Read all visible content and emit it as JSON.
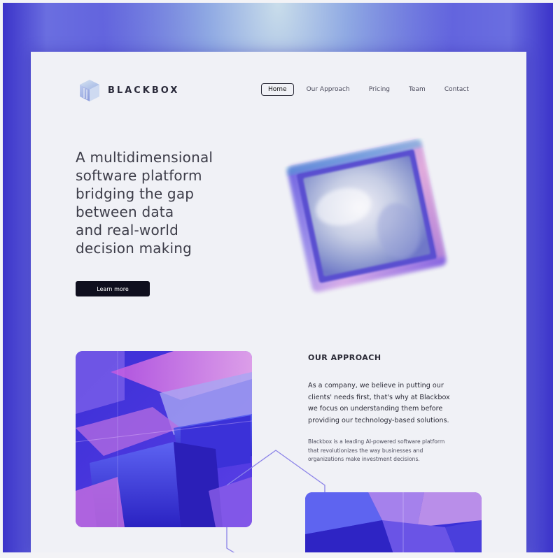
{
  "brand": {
    "name": "BLACKBOX",
    "logo_icon": "cube-logo-icon"
  },
  "nav": {
    "items": [
      {
        "label": "Home",
        "active": true
      },
      {
        "label": "Our Approach",
        "active": false
      },
      {
        "label": "Pricing",
        "active": false
      },
      {
        "label": "Team",
        "active": false
      },
      {
        "label": "Contact",
        "active": false
      }
    ]
  },
  "hero": {
    "headline_lines": [
      "A multidimensional",
      "software platform",
      "bridging the gap",
      "between data",
      "and real-world",
      "decision making"
    ],
    "cta_label": "Learn more"
  },
  "approach": {
    "title": "OUR APPROACH",
    "lead_lines": [
      "As a company, we believe in putting our",
      "clients' needs first, that's why at Blackbox",
      "we focus on understanding them before",
      "providing our technology-based solutions."
    ],
    "body_lines": [
      "Blackbox is a leading AI-powered software platform",
      "that revolutionizes the way businesses and",
      "organizations make investment decisions."
    ]
  },
  "colors": {
    "accent": "#4d47d8",
    "button_bg": "#0f0f1e",
    "page_bg": "#f0f1f6",
    "text_dark": "#2a2a36"
  }
}
